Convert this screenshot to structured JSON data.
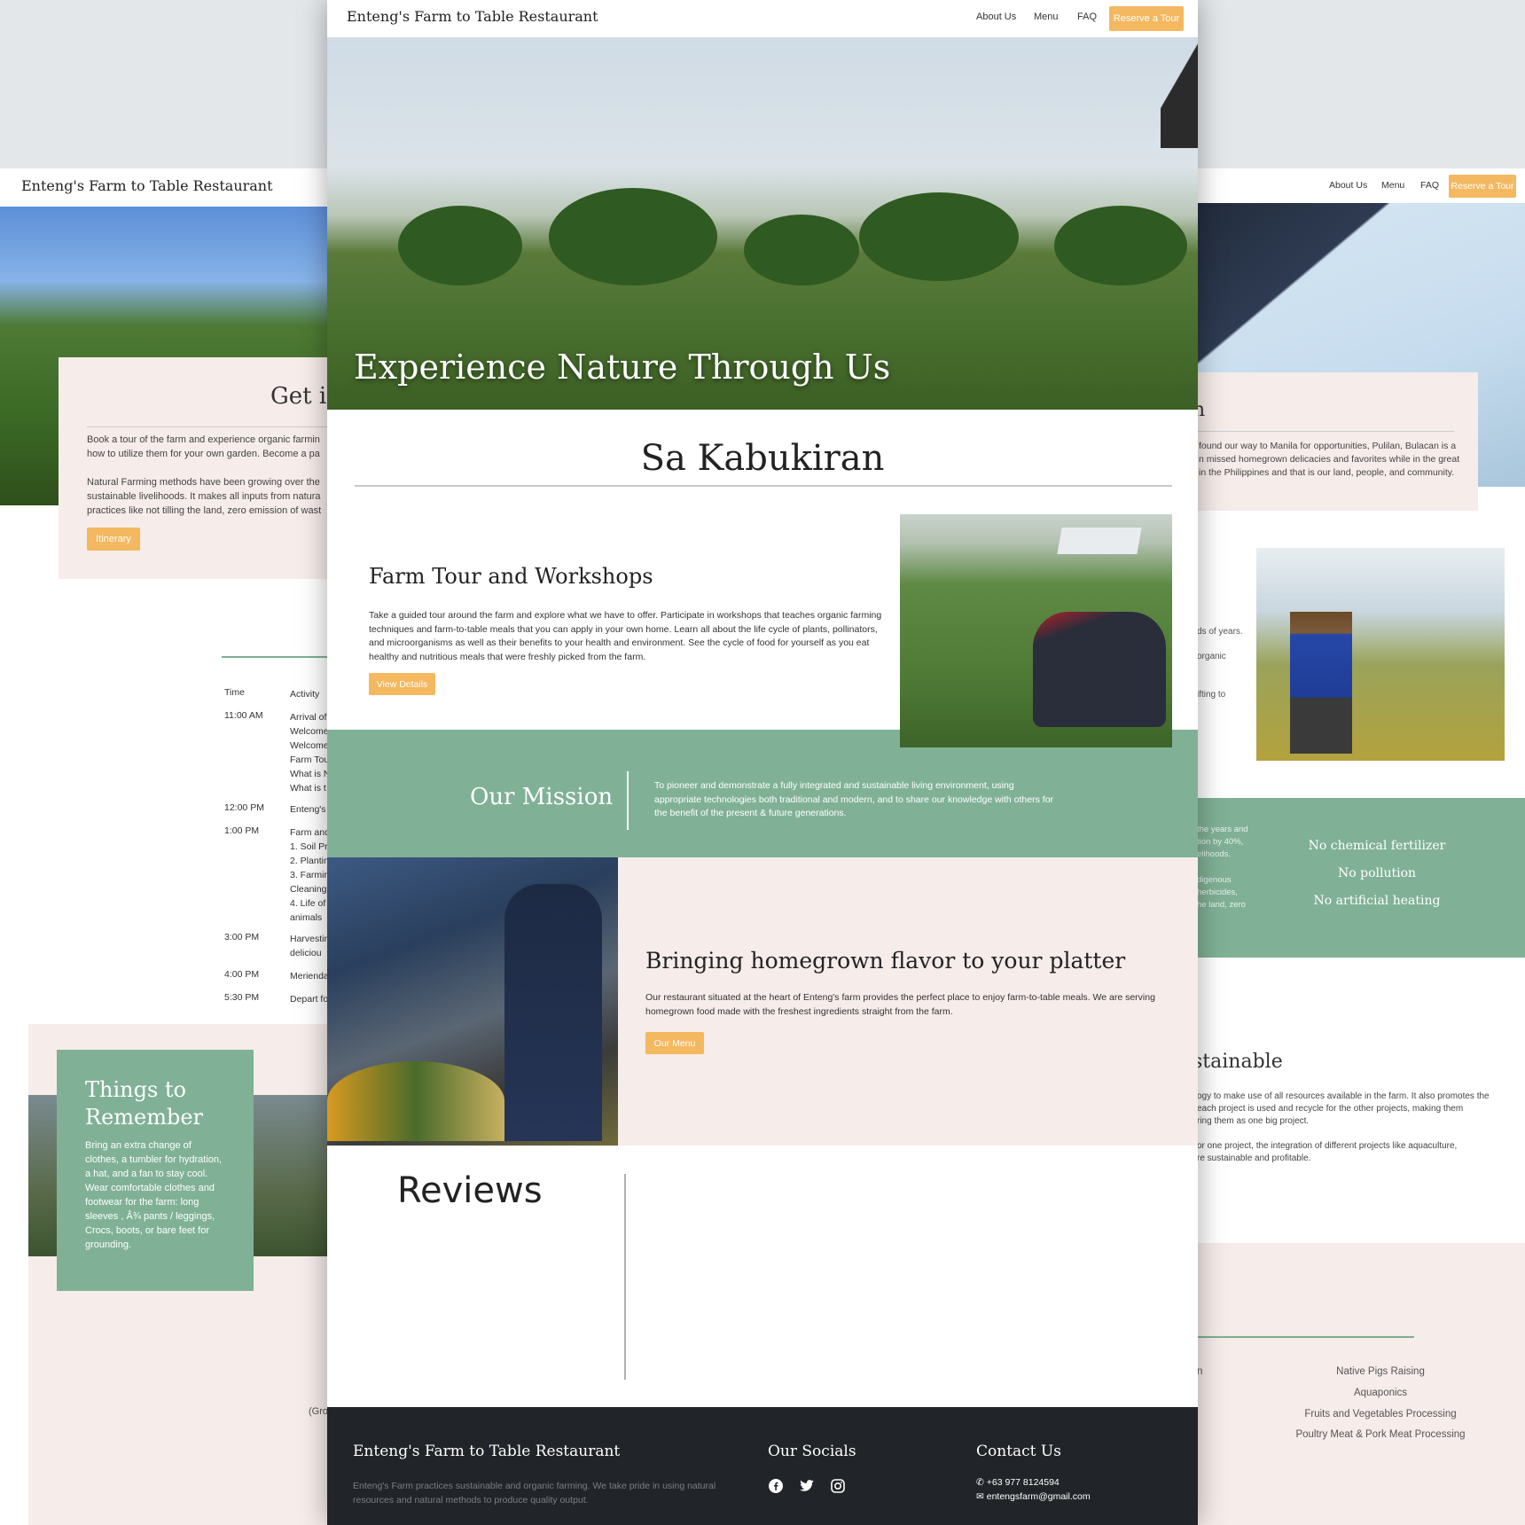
{
  "colors": {
    "accent": "#f4b860",
    "green": "#80b196",
    "pink": "#f6ece9",
    "footer": "#212529"
  },
  "left_page": {
    "brand": "Enteng's Farm to Table Restaurant",
    "card_title": "Get in",
    "card_p1": [
      "Book a tour of the farm and experience organic farmin",
      "how to utilize them for your own garden. Become a pa"
    ],
    "card_p2": [
      "Natural Farming methods have been growing over the",
      "sustainable livelihoods. It makes all inputs from natura",
      "practices like not tilling the land, zero emission of wast"
    ],
    "itinerary_button": "Itinerary",
    "schedule_header": {
      "time": "Time",
      "activity": "Activity"
    },
    "schedule": [
      {
        "time": "11:00 AM",
        "lines": [
          "Arrival of",
          "Welcome",
          "Welcome",
          "Farm Tou",
          "What is N",
          "What is t"
        ]
      },
      {
        "time": "12:00 PM",
        "lines": [
          "Enteng's"
        ]
      },
      {
        "time": "1:00 PM",
        "lines": [
          "Farm and",
          "1. Soil Pr",
          "2. Plantin",
          "3. Farmin",
          "Cleaning",
          "4. Life of",
          "animals"
        ]
      },
      {
        "time": "3:00 PM",
        "lines": [
          "Harvestin",
          "deliciou"
        ]
      },
      {
        "time": "4:00 PM",
        "lines": [
          "Merienda"
        ]
      },
      {
        "time": "5:30 PM",
        "lines": [
          "Depart fo"
        ]
      }
    ],
    "remember_title": "Things to Remember",
    "remember_text": "Bring an extra change of clothes, a tumbler for hydration, a hat, and a fan to stay cool. Wear comfortable clothes and footwear for the farm: long sleeves , Â¾ pants / leggings, Crocs, boots, or bare feet for grounding.",
    "gro_text": "(Gro"
  },
  "right_page": {
    "nav": {
      "about": "About Us",
      "menu": "Menu",
      "faq": "FAQ",
      "reserve": "Reserve a Tour"
    },
    "card_title": "n",
    "card_lines": [
      "found our way to Manila for opportunities, Pulilan, Bulacan is a",
      "n missed homegrown delicacies and favorites while in the great",
      "in the Philippines and that is our land, people, and community."
    ],
    "side_lines": [
      "ds of years.",
      "organic",
      "ifting to"
    ],
    "green_small_1": [
      "the years and",
      "tion by 40%,",
      "elihoods."
    ],
    "green_small_2": [
      "digenous",
      "herbicides,",
      "he land, zero"
    ],
    "green_list": [
      "No chemical fertilizer",
      "No pollution",
      "No artificial heating"
    ],
    "sustainable_title": "stainable",
    "sus_p1": [
      "ogy to make use of all resources available in the farm. It also promotes the",
      "each project is used and recycle for the other projects, making them",
      "ring them as one big project."
    ],
    "sus_p2": [
      "or one project, the integration of different projects like aquaculture,",
      "re sustainable and profitable."
    ],
    "pink_stub": "n",
    "projects": [
      "Native Pigs Raising",
      "Aquaponics",
      "Fruits and Vegetables Processing",
      "Poultry Meat & Pork Meat Processing"
    ]
  },
  "main": {
    "brand": "Enteng's Farm to Table Restaurant",
    "nav": {
      "about": "About Us",
      "menu": "Menu",
      "faq": "FAQ",
      "reserve": "Reserve a Tour"
    },
    "hero_title": "Experience Nature Through Us",
    "section_title": "Sa Kabukiran",
    "farm_tour": {
      "title": "Farm Tour and Workshops",
      "text": "Take a guided tour around the farm and explore what we have to offer. Participate in workshops that teaches organic farming techniques and farm-to-table meals that you can apply in your own home. Learn all about the life cycle of plants, pollinators, and microorganisms as well as their benefits to your health and environment. See the cycle of food for yourself as you eat healthy and nutritious meals that were freshly picked from the farm.",
      "button": "View Details"
    },
    "mission": {
      "title": "Our Mission",
      "text": "To pioneer and demonstrate a fully integrated and sustainable living environment, using appropriate technologies both traditional and modern, and to share our knowledge with others for the benefit of the present & future generations."
    },
    "restaurant": {
      "title": "Bringing homegrown flavor to your platter",
      "text": "Our restaurant situated at the heart of Enteng's farm provides the perfect place to enjoy farm-to-table meals. We are serving homegrown food made with the freshest ingredients straight from the farm.",
      "button": "Our Menu"
    },
    "reviews_title": "Reviews",
    "footer": {
      "brand": "Enteng's Farm to Table Restaurant",
      "description": "Enteng's Farm practices sustainable and organic farming. We take pride in using natural resources and natural methods to produce quality output.",
      "socials_title": "Our Socials",
      "contact_title": "Contact Us",
      "phone": "+63 977 8124594",
      "email": "entengsfarm@gmail.com"
    }
  }
}
